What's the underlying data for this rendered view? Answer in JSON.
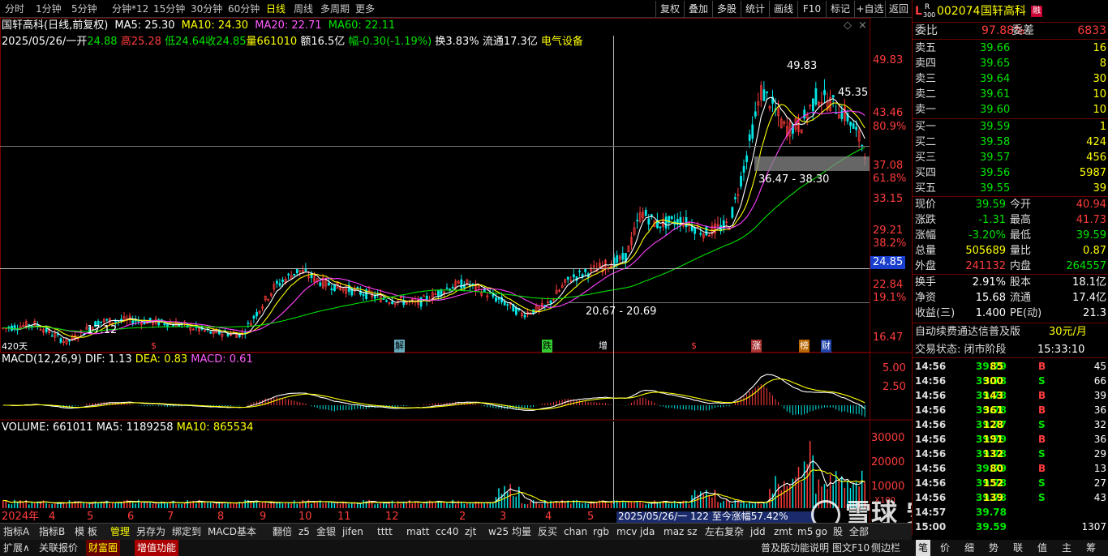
{
  "toolbar": {
    "periods": [
      "分时",
      "1分钟",
      "5分钟",
      "分钟*12",
      "15分钟",
      "30分钟",
      "60分钟",
      "日线",
      "周线",
      "多周期",
      "更多"
    ],
    "right": [
      "复权",
      "叠加",
      "多股",
      "统计",
      "画线",
      "F10",
      "标记",
      "+自选",
      "返回"
    ]
  },
  "chart": {
    "title": "国轩高科(日线,前复权)",
    "ma5": "MA5: 25.30",
    "ma10": "MA10: 24.30",
    "ma20": "MA20: 22.71",
    "ma60": "MA60: 22.11",
    "info": [
      "2025/05/26/一",
      "开",
      "24.88",
      "高",
      "25.28",
      "低",
      "24.64",
      "收",
      "24.85",
      "量",
      "661010",
      "额16.5亿",
      "幅",
      "-0.30(-1.19%)",
      "换3.83%",
      "流通17.3亿",
      "电气设备"
    ],
    "ann_high": "49.83",
    "ann_45": "45.35",
    "ann_range": "36.47 - 38.30",
    "ann_low2": "20.67 - 20.69",
    "ann_low1": "17.12",
    "days": "420天",
    "price_badge": "24.85"
  },
  "axis": {
    "prices": [
      "49.83",
      "43.46",
      "37.08",
      "33.15",
      "29.21",
      "22.84",
      "16.47"
    ],
    "pcts": [
      "80.9%",
      "61.8%",
      "38.2%",
      "19.1%"
    ]
  },
  "events": [
    "$",
    "解",
    "跌",
    "增",
    "$",
    "涨",
    "榜",
    "财"
  ],
  "macd": {
    "label": "MACD(12,26,9)",
    "dif": "DIF: 1.13",
    "dea": "DEA: 0.83",
    "macd": "MACD: 0.61",
    "ticks": [
      "5.00",
      "2.50"
    ]
  },
  "volume": {
    "label": "VOLUME: 661011",
    "ma5": "MA5: 1189258",
    "ma10": "MA10: 865534",
    "ticks": [
      "30000",
      "20000",
      "10000"
    ],
    "xunit": "X100"
  },
  "timeline": [
    "2024年",
    "4",
    "5",
    "6",
    "7",
    "8",
    "9",
    "10",
    "11",
    "12",
    "2",
    "3",
    "4",
    "5"
  ],
  "status_tip": "2025/05/26/一 122 至今涨幅57.42%",
  "stock": {
    "markL": "L",
    "markR": "R",
    "mark300": "300",
    "code": "002074",
    "name": "国轩高科",
    "tag": "融",
    "webi_label": "委比",
    "webi": "97.88%",
    "weicha_label": "委差",
    "weicha": "6833",
    "asks": [
      {
        "l": "卖五",
        "p": "39.66",
        "v": "16"
      },
      {
        "l": "卖四",
        "p": "39.65",
        "v": "8"
      },
      {
        "l": "卖三",
        "p": "39.64",
        "v": "30"
      },
      {
        "l": "卖二",
        "p": "39.61",
        "v": "10"
      },
      {
        "l": "卖一",
        "p": "39.60",
        "v": "10"
      }
    ],
    "bids": [
      {
        "l": "买一",
        "p": "39.59",
        "v": "1"
      },
      {
        "l": "买二",
        "p": "39.58",
        "v": "424"
      },
      {
        "l": "买三",
        "p": "39.57",
        "v": "456"
      },
      {
        "l": "买四",
        "p": "39.56",
        "v": "5987"
      },
      {
        "l": "买五",
        "p": "39.55",
        "v": "39"
      }
    ],
    "quote": [
      [
        "现价",
        "39.59",
        "今开",
        "40.94"
      ],
      [
        "涨跌",
        "-1.31",
        "最高",
        "41.73"
      ],
      [
        "涨幅",
        "-3.20%",
        "最低",
        "39.59"
      ],
      [
        "总量",
        "505689",
        "量比",
        "0.87"
      ],
      [
        "外盘",
        "241132",
        "内盘",
        "264557"
      ]
    ],
    "fin": [
      [
        "换手",
        "2.91%",
        "股本",
        "18.1亿"
      ],
      [
        "净资",
        "15.68",
        "流通",
        "17.4亿"
      ],
      [
        "收益(三)",
        "1.400",
        "PE(动)",
        "21.3"
      ]
    ],
    "promo": "自动续费通达信普及版",
    "promo_price": "30元/月",
    "trade_state": "交易状态: 闭市阶段",
    "trade_time": "15:33:10",
    "ticks": [
      [
        "14:56",
        "39.79",
        "85",
        "B",
        "45"
      ],
      [
        "14:56",
        "39.78",
        "300",
        "S",
        "66"
      ],
      [
        "14:56",
        "39.78",
        "143",
        "B",
        "39"
      ],
      [
        "14:56",
        "39.78",
        "361",
        "B",
        "36"
      ],
      [
        "14:56",
        "39.77",
        "128",
        "S",
        "32"
      ],
      [
        "14:56",
        "39.79",
        "191",
        "B",
        "36"
      ],
      [
        "14:56",
        "39.78",
        "132",
        "S",
        "29"
      ],
      [
        "14:56",
        "39.79",
        "80",
        "B",
        "13"
      ],
      [
        "14:56",
        "39.78",
        "152",
        "S",
        "27"
      ],
      [
        "14:56",
        "39.78",
        "139",
        "S",
        "43"
      ],
      [
        "14:57",
        "39.78",
        "",
        "",
        ""
      ],
      [
        "15:00",
        "39.59",
        "",
        "",
        "1307"
      ]
    ],
    "tabs": [
      "笔",
      "价",
      "细",
      "势",
      "联",
      "值",
      "主",
      "筹"
    ]
  },
  "bottom": [
    "指标A",
    "指标B",
    "模 板",
    "管理",
    "另存为",
    "绑定到",
    "MACD基本",
    "翻倍",
    "z5",
    "金银",
    "jifen",
    "tttt",
    "matt",
    "cc40",
    "zjt",
    "w25",
    "均量",
    "反买",
    "chan",
    "rgb",
    "mcv",
    "jda",
    "maz",
    "sz",
    "左右复杂",
    "jdd",
    "zmt",
    "m5",
    "go",
    "股",
    "全部"
  ],
  "bottom2": [
    "扩展∧",
    "关联报价",
    "财富圈",
    "增值功能"
  ],
  "status_right": [
    "普及版功能说明",
    "图文F10",
    "侧边栏"
  ],
  "watermark": "雪球 安常投资"
}
